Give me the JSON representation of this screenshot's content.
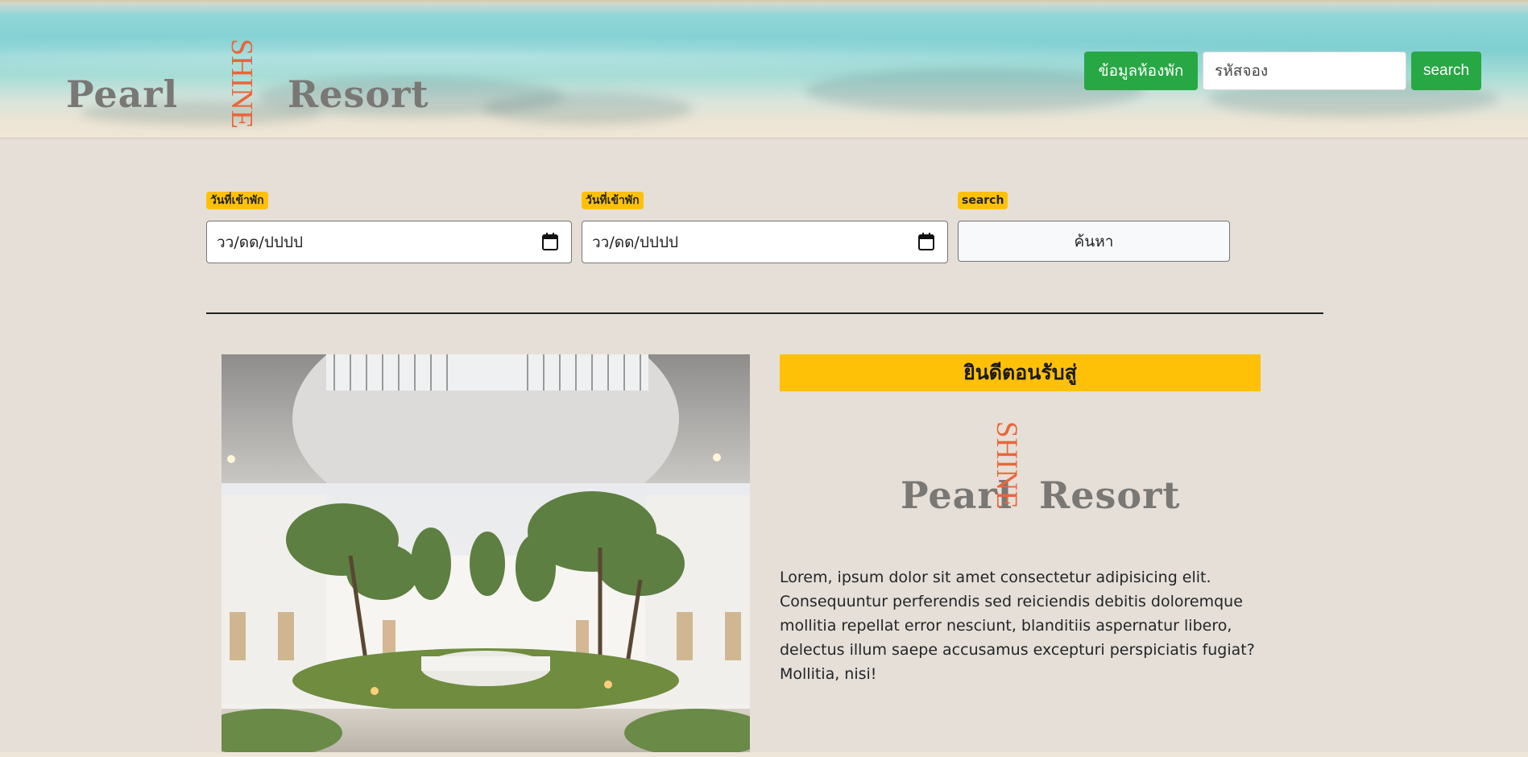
{
  "header": {
    "logo": {
      "left_word": "Pearl",
      "vertical_word": "SHINE",
      "right_word": "Resort"
    },
    "room_info_button": "ข้อมูลห้องพัก",
    "booking_code_input": {
      "placeholder": "รหัสจอง",
      "value": ""
    },
    "search_button": "search"
  },
  "filter": {
    "checkin_label": "วันที่เข้าพัก",
    "checkin_value": "วว/ดด/ปปปป",
    "checkout_label": "วันที่เข้าพัก",
    "checkout_value": "วว/ดด/ปปปป",
    "search_label": "search",
    "search_button": "ค้นหา"
  },
  "welcome": {
    "title": "ยินดีตอนรับสู่",
    "logo": {
      "left_word": "Pearl",
      "vertical_word": "SHINE",
      "right_word": "Resort"
    },
    "description": "Lorem, ipsum dolor sit amet consectetur adipisicing elit. Consequuntur perferendis sed reiciendis debitis doloremque mollitia repellat error nesciunt, blanditiis aspernatur libero, delectus illum saepe accusamus excepturi perspiciatis fugiat? Mollitia, nisi!"
  },
  "colors": {
    "accent_green": "#28a745",
    "badge_yellow": "#ffc107",
    "logo_orange": "#e8663a",
    "page_background": "#e6dfd7"
  }
}
